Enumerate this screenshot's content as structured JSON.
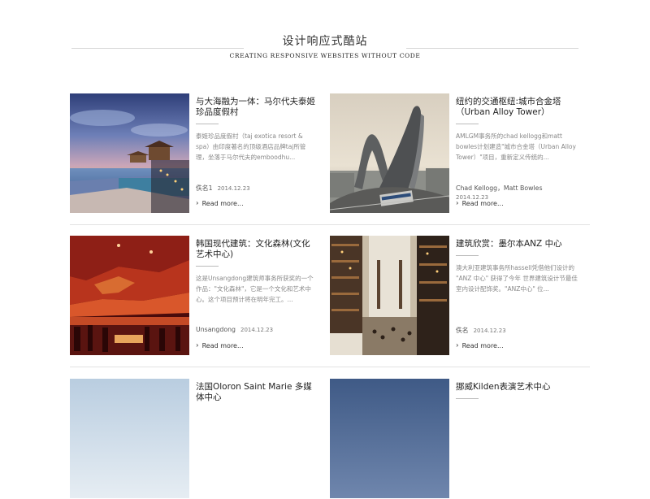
{
  "header": {
    "title": "设计响应式酷站",
    "subtitle": "CREATING RESPONSIVE WEBSITES WITHOUT CODE"
  },
  "cards": [
    {
      "title": "与大海融为一体：马尔代夫泰姬珍品度假村",
      "desc": "泰姬珍品度假村（taj exotica resort & spa）由印度著名的顶级酒店品牌taj所管理，坐落于马尔代夫的emboodhu...",
      "author": "佚名1",
      "date": "2014.12.23",
      "more": "Read more..."
    },
    {
      "title": "纽约的交通枢纽:城市合金塔（Urban Alloy Tower）",
      "desc": "AMLGM事务所的chad kellogg和matt bowles计划建造\"城市合金塔（Urban Alloy Tower）\"项目，重新定义传统的...",
      "author": "Chad Kellogg，Matt Bowles",
      "date": "2014.12.23",
      "more": "Read more..."
    },
    {
      "title": "韩国现代建筑：文化森林(文化艺术中心)",
      "desc": "这是Unsangdong建筑师事务所获奖的一个作品：\"文化森林\"，它是一个文化和艺术中心。这个项目预计将在明年完工。...",
      "author": "Unsangdong",
      "date": "2014.12.23",
      "more": "Read more..."
    },
    {
      "title": "建筑欣赏：墨尔本ANZ 中心",
      "desc": "澳大利亚建筑事务所hassell凭借他们设计的 \"ANZ 中心\" 获得了今年 世界建筑设计节最佳室内设计配饰奖。\"ANZ中心\" 位...",
      "author": "佚名",
      "date": "2014.12.23",
      "more": "Read more..."
    },
    {
      "title": "法国Oloron Saint Marie 多媒体中心"
    },
    {
      "title": "挪威Kilden表演艺术中心"
    }
  ]
}
